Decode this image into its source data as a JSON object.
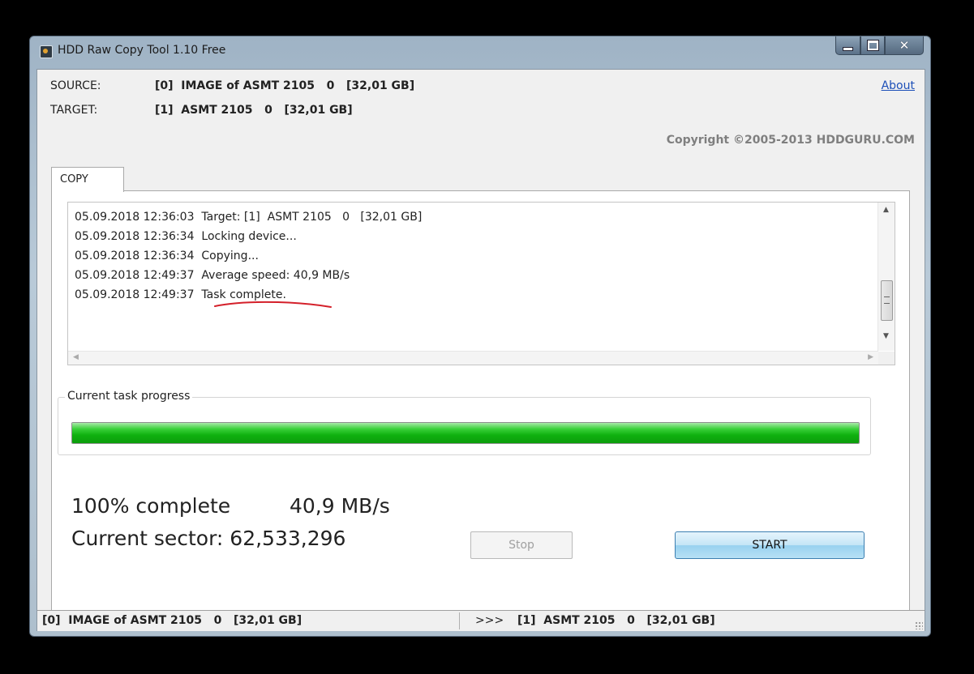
{
  "window": {
    "title": "HDD Raw Copy Tool 1.10   Free"
  },
  "header": {
    "source_label": "SOURCE:",
    "source_value": "[0]  IMAGE of ASMT 2105   0   [32,01 GB]",
    "target_label": "TARGET:",
    "target_value": "[1]  ASMT 2105   0   [32,01 GB]",
    "about_label": "About",
    "copyright": "Copyright ©2005-2013 HDDGURU.COM"
  },
  "tabs": [
    {
      "label": "COPY"
    }
  ],
  "log": {
    "lines": [
      {
        "time": "05.09.2018 12:36:03",
        "message": "Target: [1]  ASMT 2105   0   [32,01 GB]"
      },
      {
        "time": "05.09.2018 12:36:34",
        "message": "Locking device..."
      },
      {
        "time": "05.09.2018 12:36:34",
        "message": "Copying..."
      },
      {
        "time": "05.09.2018 12:49:37",
        "message": "Average speed: 40,9 MB/s"
      },
      {
        "time": "05.09.2018 12:49:37",
        "message": "Task complete."
      }
    ]
  },
  "progress": {
    "group_label": "Current task progress",
    "value_percent": 100,
    "percent_text": "100% complete",
    "speed_text": "40,9 MB/s",
    "sector_text": "Current sector: 62,533,296"
  },
  "buttons": {
    "stop_label": "Stop",
    "start_label": "START"
  },
  "statusbar": {
    "source": "[0]  IMAGE of ASMT 2105   0   [32,01 GB]",
    "arrow": ">>>",
    "target": "[1]  ASMT 2105   0   [32,01 GB]"
  },
  "colors": {
    "progress_fill": "#0fb10f",
    "link": "#1c4fb8",
    "annotation_underline": "#d4202a"
  }
}
